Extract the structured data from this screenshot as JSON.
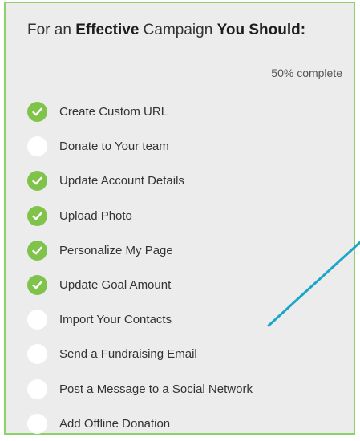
{
  "checklist": {
    "title_parts": [
      {
        "text": "For an ",
        "bold": false
      },
      {
        "text": "Effective",
        "bold": true
      },
      {
        "text": " Campaign ",
        "bold": false
      },
      {
        "text": "You Should:",
        "bold": true
      }
    ],
    "progress_text": "50% complete",
    "progress_fraction": 0.5,
    "items": [
      {
        "label": "Create Custom URL",
        "done": true
      },
      {
        "label": "Donate to Your team",
        "done": false
      },
      {
        "label": "Update Account Details",
        "done": true
      },
      {
        "label": "Upload Photo",
        "done": true
      },
      {
        "label": "Personalize My Page",
        "done": true
      },
      {
        "label": "Update Goal Amount",
        "done": true
      },
      {
        "label": "Import Your Contacts",
        "done": false
      },
      {
        "label": "Send a Fundraising Email",
        "done": false
      },
      {
        "label": "Post a Message to a Social Network",
        "done": false
      },
      {
        "label": "Add Offline Donation",
        "done": false
      }
    ]
  },
  "colors": {
    "border": "#8ed16a",
    "check_done": "#7fc34b",
    "check_todo": "#ffffff",
    "annotation_line": "#1ba6c9",
    "panel_bg": "#ececec"
  },
  "icons": {
    "done": "checkmark-icon",
    "todo": "empty-circle-icon"
  }
}
